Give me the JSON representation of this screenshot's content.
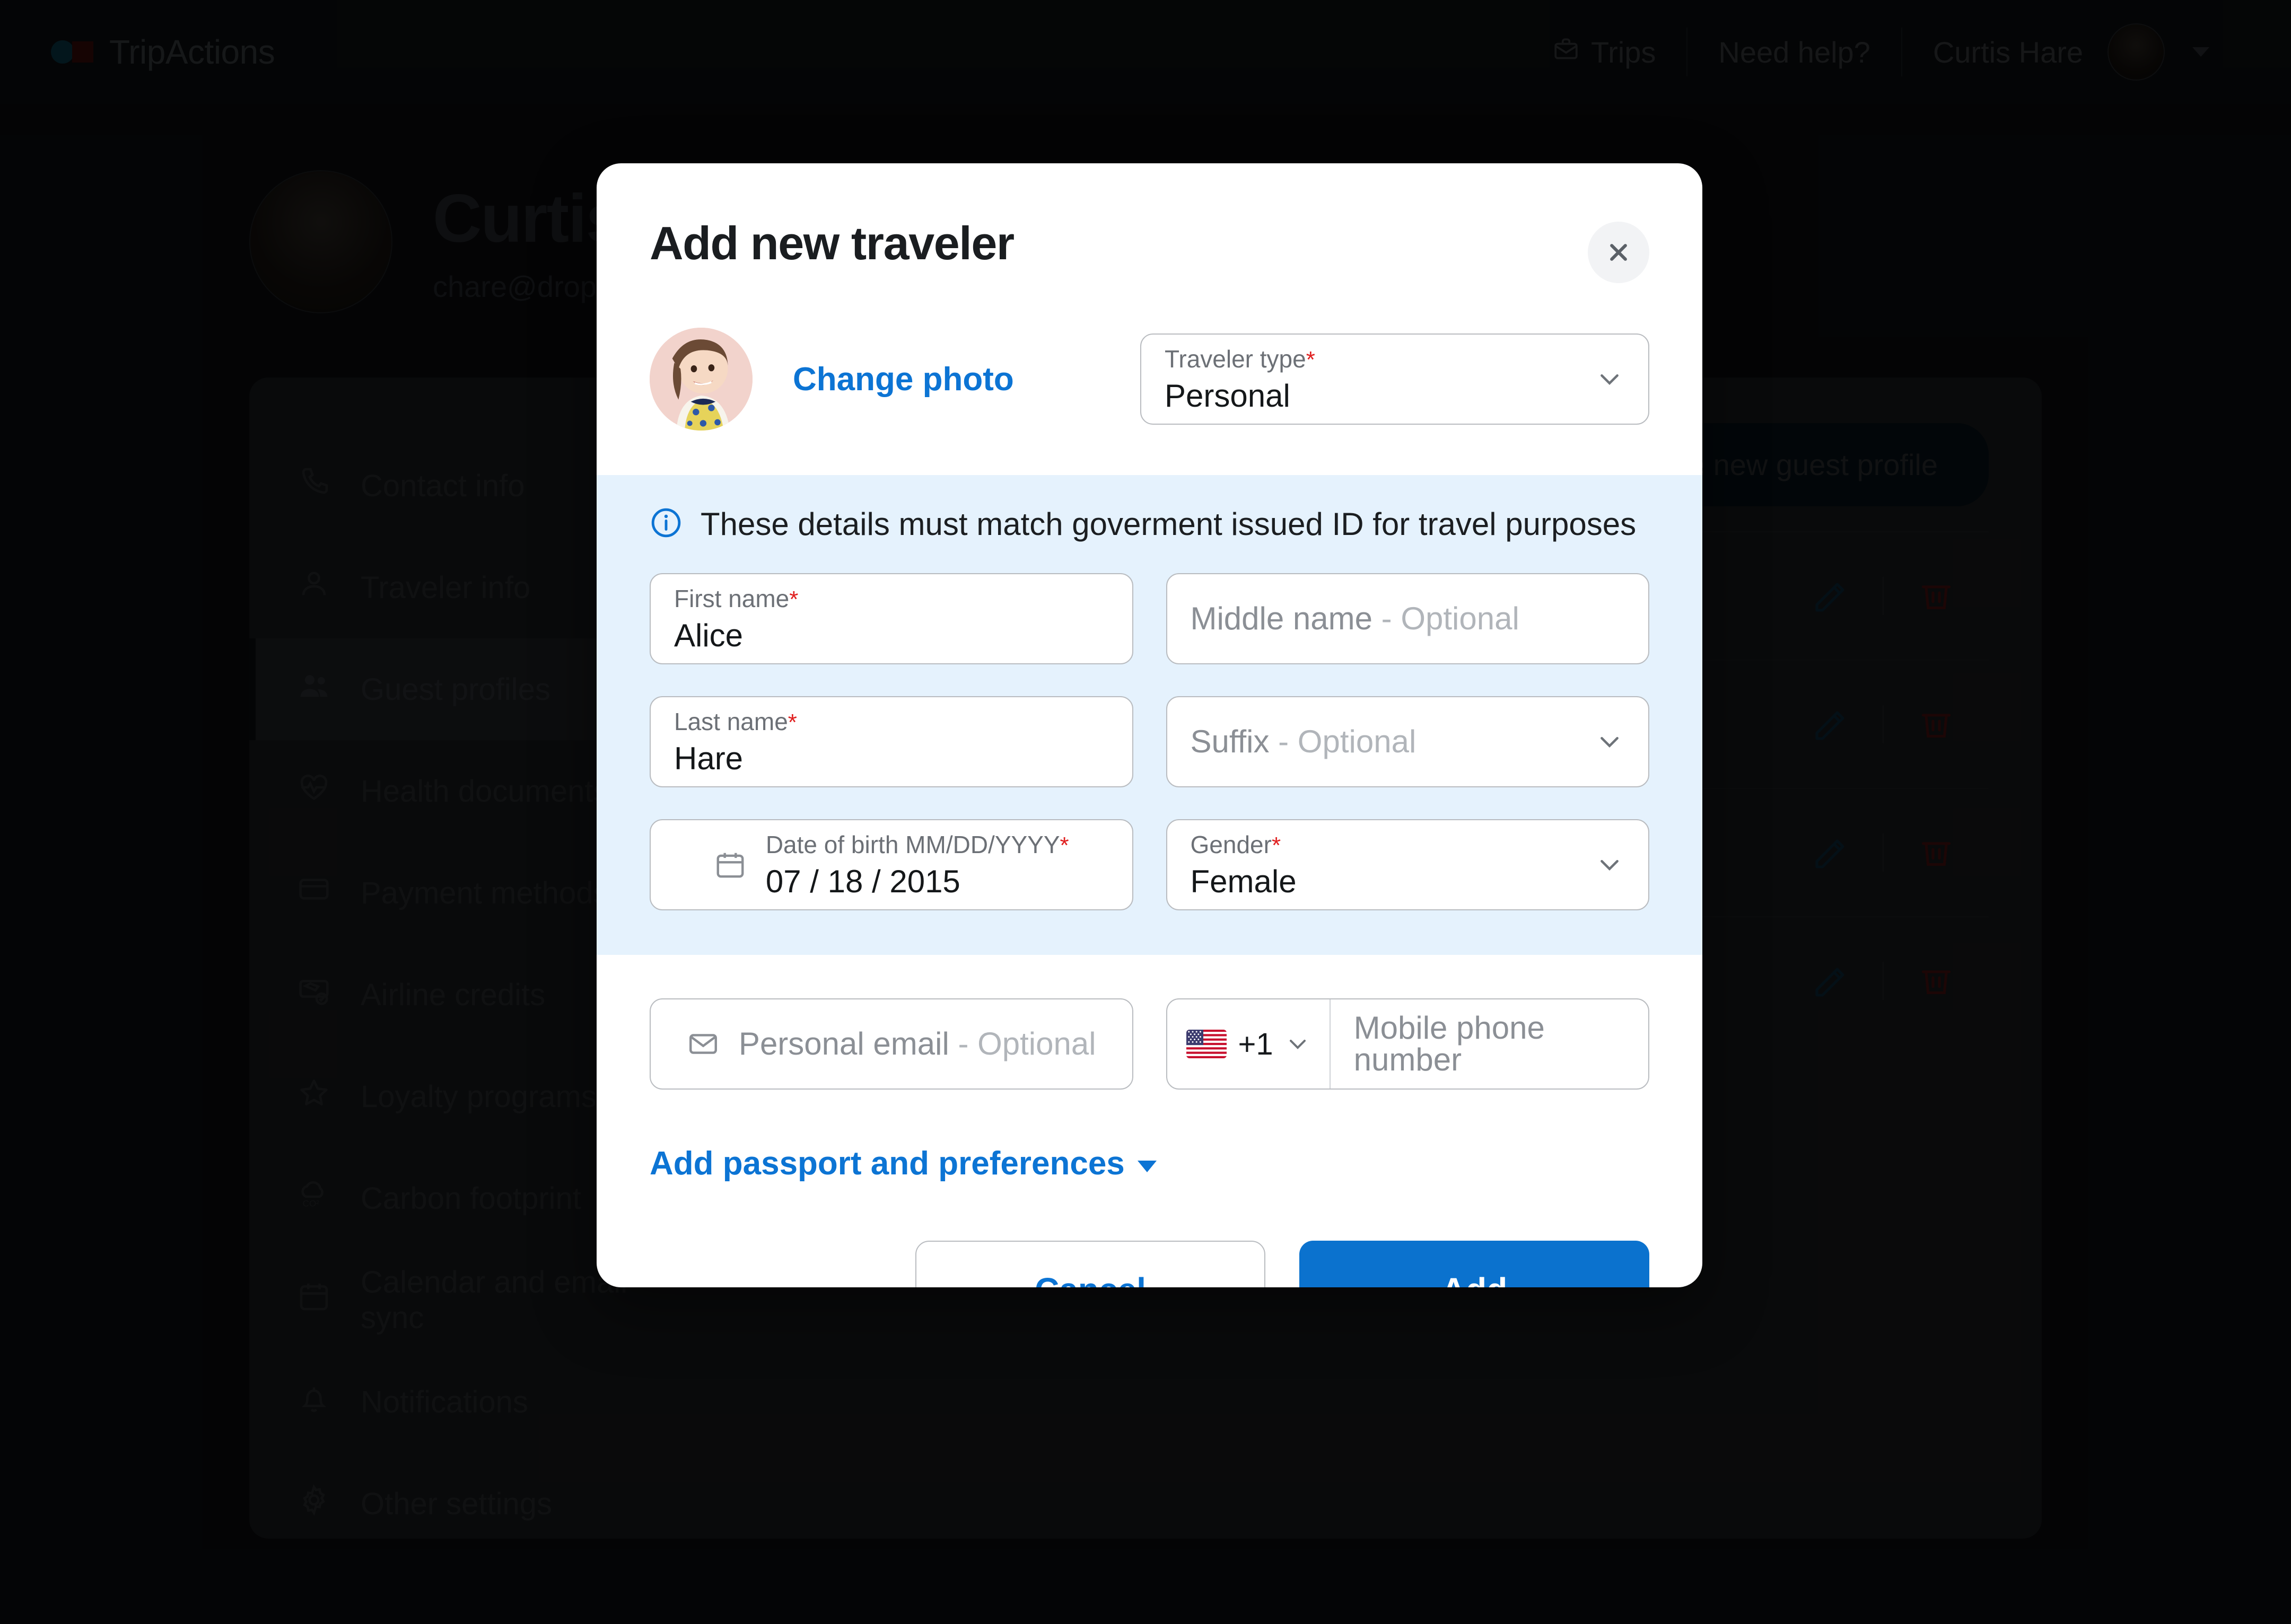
{
  "topnav": {
    "brand": "TripActions",
    "items": [
      {
        "label": "Trips",
        "icon": "briefcase-icon"
      },
      {
        "label": "Need help?",
        "icon": null
      },
      {
        "label": "Curtis Hare",
        "icon": null
      }
    ]
  },
  "hero": {
    "name": "Curtis Hare",
    "email": "chare@dropbox.com"
  },
  "sidebar": {
    "items": [
      {
        "label": "Contact info",
        "icon": "phone-icon",
        "active": false
      },
      {
        "label": "Traveler info",
        "icon": "person-icon",
        "active": false
      },
      {
        "label": "Guest profiles",
        "icon": "people-icon",
        "active": true
      },
      {
        "label": "Health documents",
        "icon": "heart-pulse-icon",
        "active": false
      },
      {
        "label": "Payment methods",
        "icon": "credit-card-icon",
        "active": false
      },
      {
        "label": "Airline credits",
        "icon": "ticket-plane-icon",
        "active": false
      },
      {
        "label": "Loyalty programs",
        "icon": "star-icon",
        "active": false
      },
      {
        "label": "Carbon footprint",
        "icon": "co2-cloud-icon",
        "active": false
      },
      {
        "label": "Calendar and email sync",
        "icon": "calendar-icon",
        "active": false
      },
      {
        "label": "Notifications",
        "icon": "bell-icon",
        "active": false
      },
      {
        "label": "Other settings",
        "icon": "gear-icon",
        "active": false
      }
    ]
  },
  "main": {
    "create_button": "Create new guest profile",
    "rows": [
      {
        "edit": "edit-icon",
        "delete": "trash-icon"
      },
      {
        "edit": "edit-icon",
        "delete": "trash-icon"
      },
      {
        "edit": "edit-icon",
        "delete": "trash-icon"
      },
      {
        "edit": "edit-icon",
        "delete": "trash-icon"
      }
    ]
  },
  "modal": {
    "title": "Add new traveler",
    "close_label": "close-icon",
    "change_photo": "Change photo",
    "traveler_type": {
      "label": "Traveler type",
      "required": "*",
      "value": "Personal"
    },
    "info_banner": "These details must match goverment issued ID for travel purposes",
    "fields": {
      "first_name": {
        "label": "First name",
        "required": "*",
        "value": "Alice"
      },
      "middle_name": {
        "placeholder": "Middle name",
        "optional_suffix": " - Optional"
      },
      "last_name": {
        "label": "Last name",
        "required": "*",
        "value": "Hare"
      },
      "suffix": {
        "placeholder": "Suffix",
        "optional_suffix": " - Optional"
      },
      "date_of_birth": {
        "label": "Date of birth MM/DD/YYYY",
        "required": "*",
        "value": "07 / 18 / 2015"
      },
      "gender": {
        "label": "Gender",
        "required": "*",
        "value": "Female"
      },
      "personal_email": {
        "placeholder": "Personal email",
        "optional_suffix": " - Optional"
      },
      "phone_country_code": "+1",
      "phone": {
        "placeholder": "Mobile phone number"
      }
    },
    "add_passport": "Add passport and preferences",
    "cancel_label": "Cancel",
    "add_label": "Add"
  },
  "colors": {
    "accent_blue": "#0b72ce",
    "link_blue": "#0c74d4",
    "info_band": "#e5f2fd",
    "required_red": "#e02020",
    "border_gray": "#b9bcc0"
  }
}
